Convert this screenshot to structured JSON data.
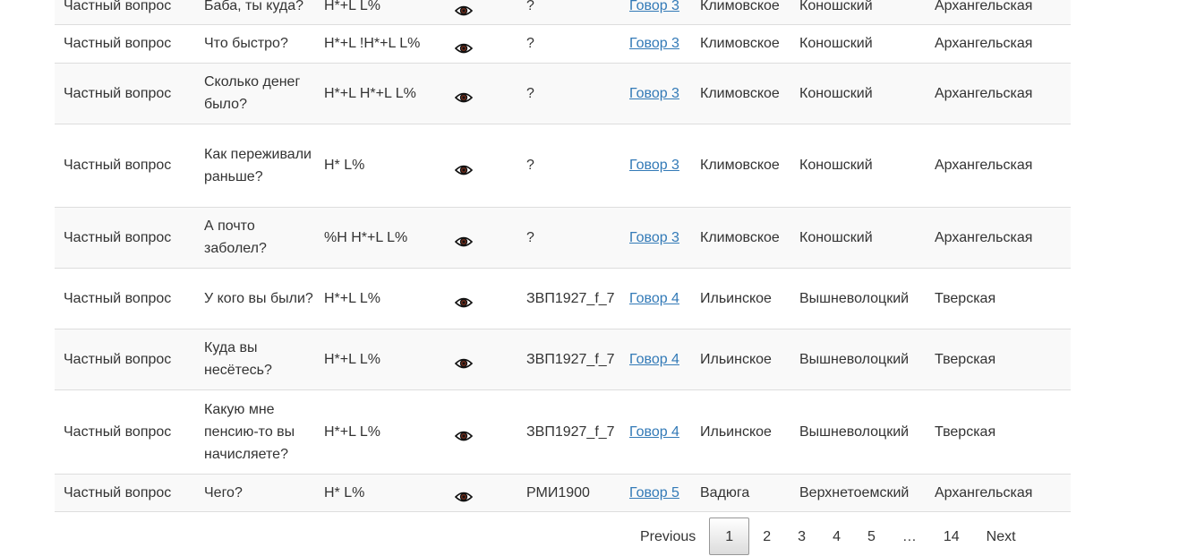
{
  "table": {
    "rows": [
      {
        "type": "Частный вопрос",
        "utterance": "Баба, ты куда?",
        "tones": "H*+L L%",
        "speaker": "?",
        "dialect": "Говор 3",
        "village": "Климовское",
        "district": "Коношский",
        "region": "Архангельская"
      },
      {
        "type": "Частный вопрос",
        "utterance": "Что быстро?",
        "tones": "H*+L !H*+L L%",
        "speaker": "?",
        "dialect": "Говор 3",
        "village": "Климовское",
        "district": "Коношский",
        "region": "Архангельская"
      },
      {
        "type": "Частный вопрос",
        "utterance": "Сколько денег было?",
        "tones": "H*+L H*+L L%",
        "speaker": "?",
        "dialect": "Говор 3",
        "village": "Климовское",
        "district": "Коношский",
        "region": "Архангельская"
      },
      {
        "type": "Частный вопрос",
        "utterance": "Как переживали раньше?",
        "tones": "H* L%",
        "speaker": "?",
        "dialect": "Говор 3",
        "village": "Климовское",
        "district": "Коношский",
        "region": "Архангельская"
      },
      {
        "type": "Частный вопрос",
        "utterance": "А почто заболел?",
        "tones": "%H H*+L L%",
        "speaker": "?",
        "dialect": "Говор 3",
        "village": "Климовское",
        "district": "Коношский",
        "region": "Архангельская"
      },
      {
        "type": "Частный вопрос",
        "utterance": "У кого вы были?",
        "tones": "H*+L L%",
        "speaker": "ЗВП1927_f_7",
        "dialect": "Говор 4",
        "village": "Ильинское",
        "district": "Вышневолоцкий",
        "region": "Тверская"
      },
      {
        "type": "Частный вопрос",
        "utterance": "Куда вы несётесь?",
        "tones": "H*+L L%",
        "speaker": "ЗВП1927_f_7",
        "dialect": "Говор 4",
        "village": "Ильинское",
        "district": "Вышневолоцкий",
        "region": "Тверская"
      },
      {
        "type": "Частный вопрос",
        "utterance": "Какую мне пенсию-то вы начисляете?",
        "tones": "H*+L L%",
        "speaker": "ЗВП1927_f_7",
        "dialect": "Говор 4",
        "village": "Ильинское",
        "district": "Вышневолоцкий",
        "region": "Тверская"
      },
      {
        "type": "Частный вопрос",
        "utterance": "Чего?",
        "tones": "H* L%",
        "speaker": "РМИ1900",
        "dialect": "Говор 5",
        "village": "Вадюга",
        "district": "Верхнетоемский",
        "region": "Архангельская"
      }
    ]
  },
  "pagination": {
    "previous": "Previous",
    "pages": [
      "1",
      "2",
      "3",
      "4",
      "5"
    ],
    "ellipsis": "…",
    "last": "14",
    "next": "Next",
    "current": "1"
  },
  "icons": {
    "view": "eye-icon"
  }
}
